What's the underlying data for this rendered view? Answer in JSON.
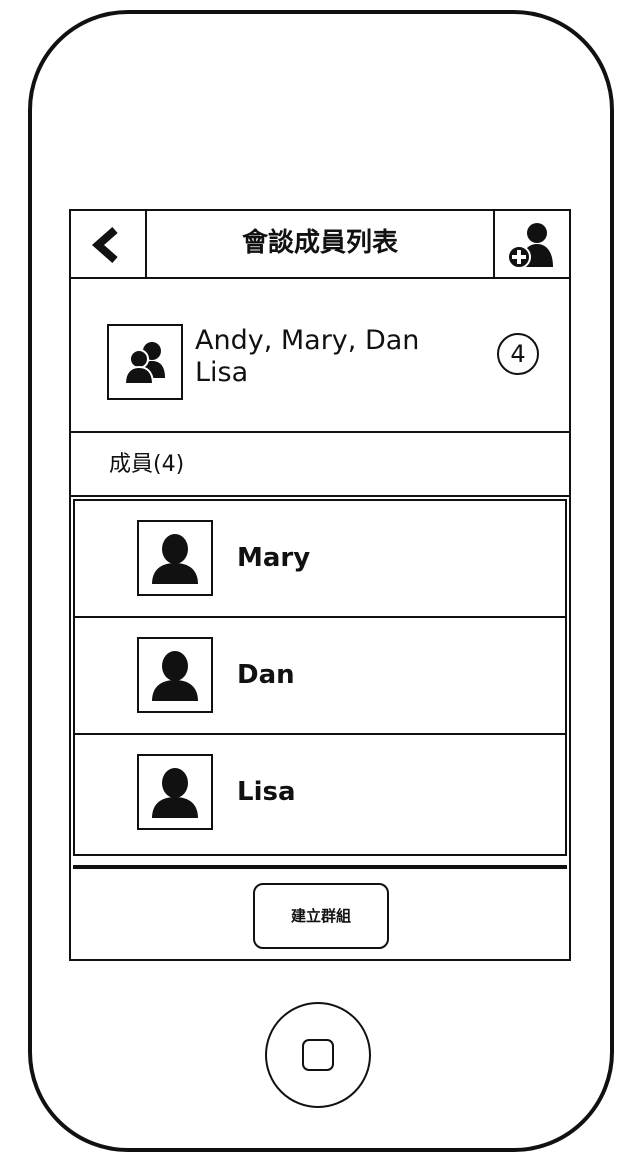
{
  "navbar": {
    "title": "會談成員列表",
    "back_icon": "chevron-left-icon",
    "add_icon": "add-user-icon"
  },
  "summary": {
    "names_line1": "Andy, Mary, Dan",
    "names_line2": "Lisa",
    "count": "4",
    "avatar_icon": "group-icon"
  },
  "section": {
    "title": "成員(4)"
  },
  "members": [
    {
      "name": "Mary",
      "icon": "user-icon"
    },
    {
      "name": "Dan",
      "icon": "user-icon"
    },
    {
      "name": "Lisa",
      "icon": "user-icon"
    }
  ],
  "create_button": {
    "label": "建立群組"
  },
  "device": {
    "home_icon": "home-button-icon"
  }
}
